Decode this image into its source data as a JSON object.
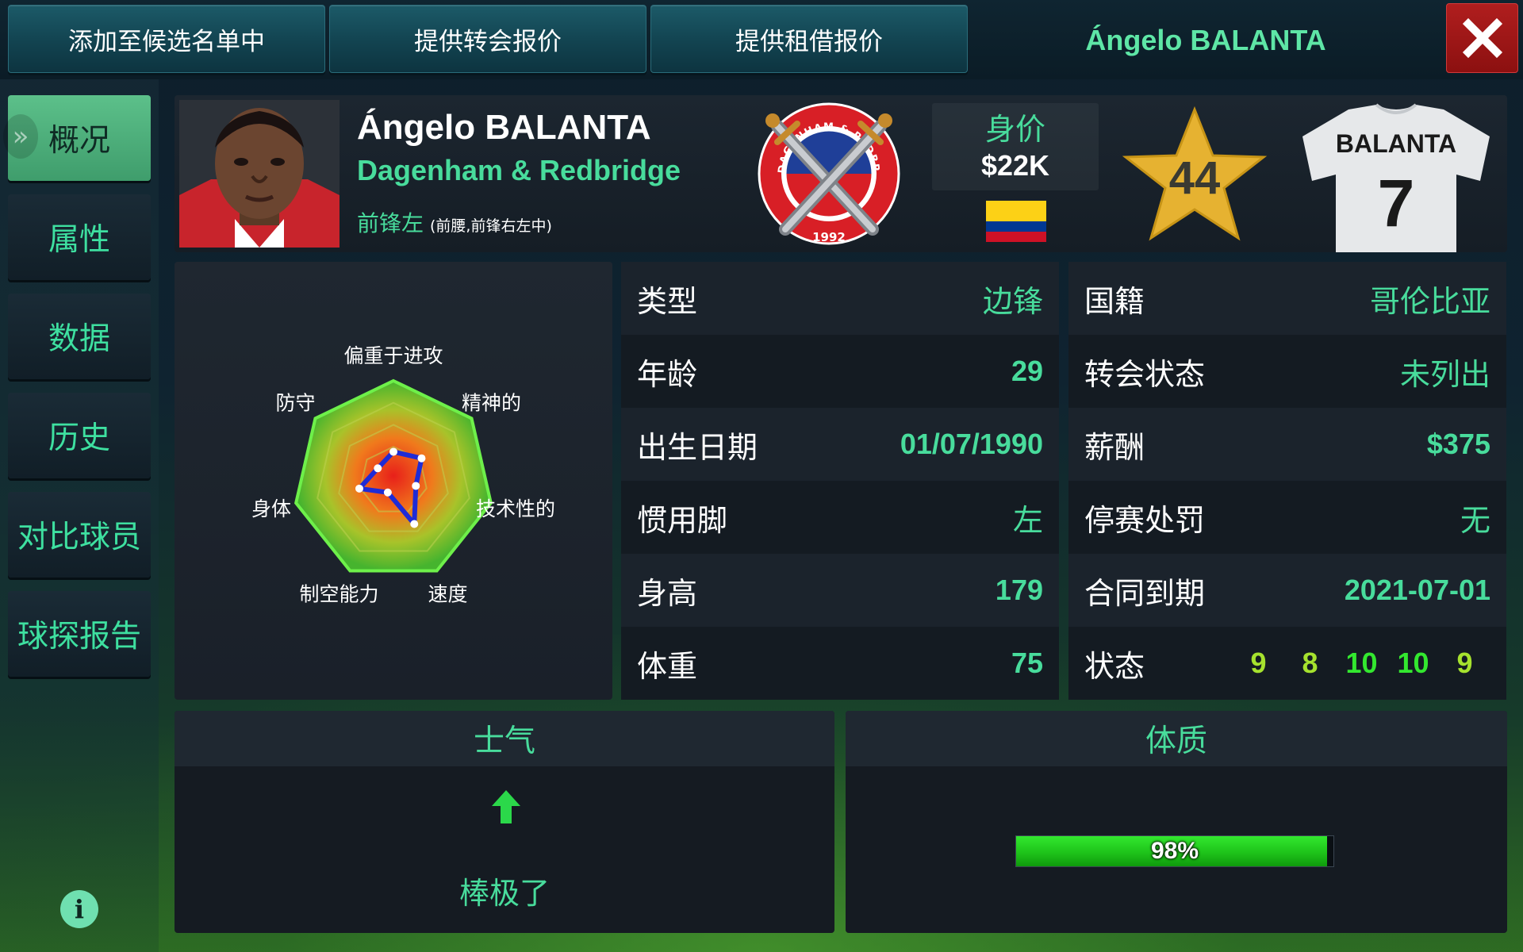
{
  "top_bar": {
    "shortlist_label": "添加至候选名单中",
    "transfer_offer_label": "提供转会报价",
    "loan_offer_label": "提供租借报价",
    "title": "Ángelo BALANTA",
    "close_icon": "close-icon"
  },
  "sidebar": {
    "items": [
      {
        "label": "概况",
        "active": true
      },
      {
        "label": "属性",
        "active": false
      },
      {
        "label": "数据",
        "active": false
      },
      {
        "label": "历史",
        "active": false
      },
      {
        "label": "对比球员",
        "active": false
      },
      {
        "label": "球探报告",
        "active": false
      }
    ],
    "info_icon": "info-icon"
  },
  "player": {
    "name": "Ángelo BALANTA",
    "club": "Dagenham & Redbridge",
    "position": "前锋左",
    "alt_positions": "(前腰,前锋右左中)",
    "value_label": "身价",
    "value": "$22K",
    "rating": "44",
    "shirt_name": "BALANTA",
    "shirt_number": "7",
    "crest": {
      "top_text": "DAGENHAM & REDBRIDGE FC",
      "year": "1992"
    },
    "flag_colors": [
      "#fcd116",
      "#003893",
      "#ce1126"
    ]
  },
  "radar": {
    "labels": [
      "偏重于进攻",
      "精神的",
      "技术性的",
      "速度",
      "制空能力",
      "身体",
      "防守"
    ],
    "values": [
      0.29,
      0.36,
      0.23,
      0.48,
      0.13,
      0.35,
      0.2
    ]
  },
  "stats_left": [
    {
      "label": "类型",
      "value": "边锋"
    },
    {
      "label": "年龄",
      "value": "29"
    },
    {
      "label": "出生日期",
      "value": "01/07/1990"
    },
    {
      "label": "惯用脚",
      "value": "左"
    },
    {
      "label": "身高",
      "value": "179"
    },
    {
      "label": "体重",
      "value": "75"
    }
  ],
  "stats_right": [
    {
      "label": "国籍",
      "value": "哥伦比亚"
    },
    {
      "label": "转会状态",
      "value": "未列出"
    },
    {
      "label": "薪酬",
      "value": "$375"
    },
    {
      "label": "停赛处罚",
      "value": "无"
    },
    {
      "label": "合同到期",
      "value": "2021-07-01"
    },
    {
      "label": "状态",
      "value": ""
    }
  ],
  "form": [
    {
      "value": "9",
      "color": "#a6e22e"
    },
    {
      "value": "8",
      "color": "#a6e22e"
    },
    {
      "value": "10",
      "color": "#33e82f"
    },
    {
      "value": "10",
      "color": "#33e82f"
    },
    {
      "value": "9",
      "color": "#a6e22e"
    }
  ],
  "morale": {
    "title": "士气",
    "text": "棒极了",
    "icon": "arrow-up-icon"
  },
  "fitness": {
    "title": "体质",
    "percent": 98,
    "label": "98%"
  },
  "colors": {
    "accent": "#48dc9c",
    "active_tab": "#5cc08a",
    "close": "#a8181c",
    "star": "#e6b231"
  }
}
